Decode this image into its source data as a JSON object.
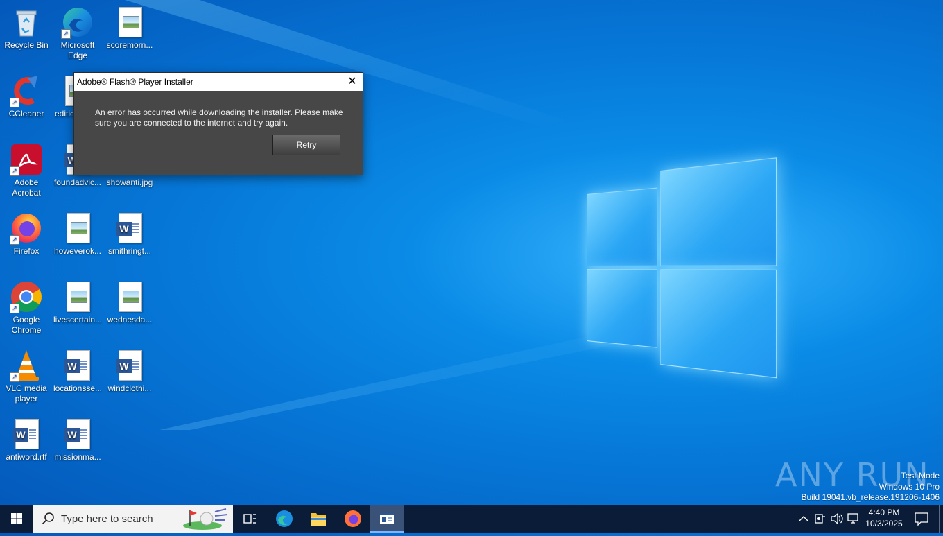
{
  "desktop": {
    "icons": [
      {
        "label": "Recycle Bin"
      },
      {
        "label": "Microsoft Edge"
      },
      {
        "label": "scoremorn..."
      },
      {
        "label": "CCleaner"
      },
      {
        "label": "editic"
      },
      {
        "label": "Adobe Acrobat"
      },
      {
        "label": "foundadvic..."
      },
      {
        "label": "showanti.jpg"
      },
      {
        "label": "Firefox"
      },
      {
        "label": "howeverok..."
      },
      {
        "label": "smithringt..."
      },
      {
        "label": "Google Chrome"
      },
      {
        "label": "livescertain..."
      },
      {
        "label": "wednesda..."
      },
      {
        "label": "VLC media player"
      },
      {
        "label": "locationsse..."
      },
      {
        "label": "windclothi..."
      },
      {
        "label": "antiword.rtf"
      },
      {
        "label": "missionma..."
      }
    ]
  },
  "dialog": {
    "title": "Adobe® Flash® Player Installer",
    "close_glyph": "✕",
    "message": "An error has occurred while downloading the installer. Please make sure you are connected to the internet and try again.",
    "retry_label": "Retry"
  },
  "watermark": {
    "text": "ANY RUN",
    "test_mode": "Test Mode",
    "edition": "Windows 10 Pro",
    "build": "Build 19041.vb_release.191206-1406"
  },
  "taskbar": {
    "search_placeholder": "Type here to search",
    "time": "4:40 PM",
    "date": "10/3/2025",
    "apps": [
      "task-view",
      "microsoft-edge",
      "file-explorer",
      "firefox",
      "flash-installer"
    ],
    "tray_icons": [
      "chevron-up-icon",
      "network-monitor-icon",
      "volume-icon",
      "network-icon",
      "notification-icon"
    ]
  },
  "colors": {
    "desktop_accent": "#0a8be6",
    "taskbar": "#0a1c38",
    "dialog_body": "#474747"
  }
}
